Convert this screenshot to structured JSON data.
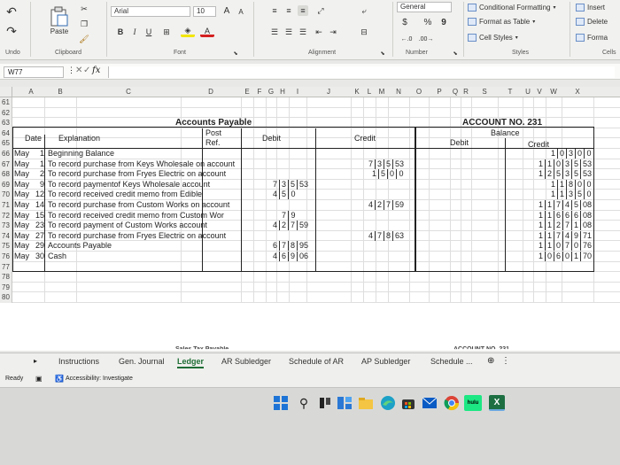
{
  "ribbon": {
    "undo_label": "Undo",
    "clipboard_label": "Clipboard",
    "paste_label": "Paste",
    "font_group_label": "Font",
    "font_name": "Arial",
    "font_size": "10",
    "grow_font": "A",
    "shrink_font": "A",
    "bold": "B",
    "italic": "I",
    "underline": "U",
    "font_color": "A",
    "alignment_label": "Alignment",
    "number_label": "Number",
    "number_format": "General",
    "currency": "$",
    "percent": "%",
    "comma": "9",
    "styles_label": "Styles",
    "conditional_formatting": "Conditional Formatting",
    "format_as_table": "Format as Table",
    "cell_styles": "Cell Styles",
    "cells_label": "Cells",
    "insert": "Insert",
    "delete": "Delete",
    "format": "Forma"
  },
  "formula_bar": {
    "name_box": "W77",
    "fx": "fx"
  },
  "columns": [
    "A",
    "B",
    "C",
    "D",
    "E",
    "F",
    "G",
    "H",
    "I",
    "J",
    "K",
    "L",
    "M",
    "N",
    "O",
    "P",
    "Q",
    "R",
    "S",
    "T",
    "U",
    "V",
    "W",
    "X"
  ],
  "rows": [
    "61",
    "62",
    "63",
    "64",
    "65",
    "66",
    "67",
    "68",
    "69",
    "70",
    "71",
    "72",
    "73",
    "74",
    "75",
    "76",
    "77",
    "78",
    "79",
    "80"
  ],
  "sheet": {
    "title": "Accounts Payable",
    "account_no": "ACCOUNT NO. 231",
    "balance": "Balance",
    "h_date": "Date",
    "h_explanation": "Explanation",
    "h_post": "Post",
    "h_ref": "Ref.",
    "h_debit": "Debit",
    "h_credit": "Credit",
    "h_bal_debit": "Debit",
    "h_bal_credit": "Credit",
    "entries": [
      {
        "month": "May",
        "day": "1",
        "text": "Beginning Balance",
        "debit": [],
        "credit": [],
        "bal": [
          "1",
          "0",
          "3",
          "0",
          "0"
        ]
      },
      {
        "month": "May",
        "day": "1",
        "text": "To record purchase from Keys Wholesale on account",
        "debit": [],
        "credit": [
          "7",
          "3",
          "5",
          "53"
        ],
        "bal": [
          "1",
          "1",
          "0",
          "3",
          "5",
          "53"
        ]
      },
      {
        "month": "May",
        "day": "2",
        "text": "To record purchase from Fryes Electric on account",
        "debit": [],
        "credit": [
          "1",
          "5",
          "0",
          "0"
        ],
        "bal": [
          "1",
          "2",
          "5",
          "3",
          "5",
          "53"
        ]
      },
      {
        "month": "May",
        "day": "9",
        "text": "To record paymentof Keys Wholesale account",
        "debit": [
          "7",
          "3",
          "5",
          "53"
        ],
        "credit": [],
        "bal": [
          "1",
          "1",
          "8",
          "0",
          "0"
        ]
      },
      {
        "month": "May",
        "day": "12",
        "text": "To record received credit memo from Edible",
        "debit": [
          "4",
          "5",
          "0"
        ],
        "credit": [],
        "bal": [
          "1",
          "1",
          "3",
          "5",
          "0"
        ]
      },
      {
        "month": "May",
        "day": "14",
        "text": "To record purchase from Custom Works on account",
        "debit": [],
        "credit": [
          "4",
          "2",
          "7",
          "59"
        ],
        "bal": [
          "1",
          "1",
          "7",
          "4",
          "5",
          "08"
        ]
      },
      {
        "month": "May",
        "day": "15",
        "text": "To record received credit memo from Custom Wor",
        "debit": [
          "7",
          "9"
        ],
        "credit": [],
        "bal": [
          "1",
          "1",
          "6",
          "6",
          "6",
          "08"
        ]
      },
      {
        "month": "May",
        "day": "23",
        "text": "To record payment of Custom Works account",
        "debit": [
          "4",
          "2",
          "7",
          "59"
        ],
        "credit": [],
        "bal": [
          "1",
          "1",
          "2",
          "7",
          "1",
          "08"
        ]
      },
      {
        "month": "May",
        "day": "27",
        "text": "To record purchase from Fryes Electric on account",
        "debit": [],
        "credit": [
          "4",
          "7",
          "8",
          "63"
        ],
        "bal": [
          "1",
          "1",
          "7",
          "4",
          "9",
          "71"
        ]
      },
      {
        "month": "May",
        "day": "29",
        "text": "Accounts Payable",
        "debit": [
          "6",
          "7",
          "8",
          "95"
        ],
        "credit": [],
        "bal": [
          "1",
          "1",
          "0",
          "7",
          "0",
          "76"
        ]
      },
      {
        "month": "May",
        "day": "30",
        "text": "Cash",
        "debit": [
          "4",
          "6",
          "9",
          "06"
        ],
        "credit": [],
        "bal": [
          "1",
          "0",
          "6",
          "0",
          "1",
          "70"
        ]
      }
    ]
  },
  "tabs": {
    "items": [
      "Instructions",
      "Gen. Journal",
      "Ledger",
      "AR Subledger",
      "Schedule of AR",
      "AP Subledger",
      "Schedule ..."
    ],
    "active": "Ledger",
    "ghost_left": "Sales Tax Payable",
    "ghost_right": "ACCOUNT NO. 231"
  },
  "status": {
    "ready": "Ready",
    "accessibility": "Accessibility: Investigate"
  },
  "taskbar": {
    "hulu": "hulu",
    "excel": "X"
  }
}
